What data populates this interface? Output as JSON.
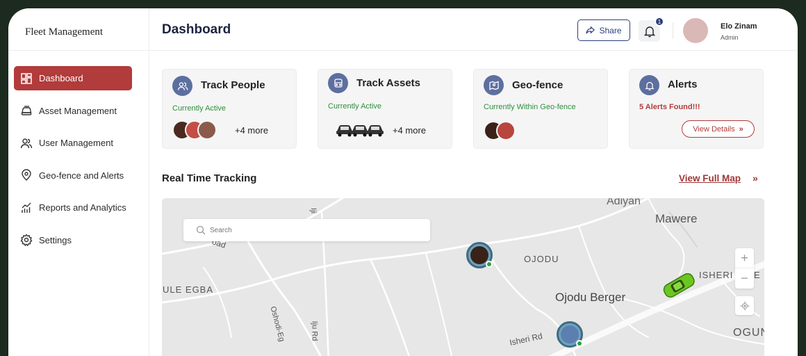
{
  "sidebar": {
    "brand": "Fleet Management",
    "items": [
      {
        "label": "Dashboard",
        "icon": "dashboard-icon"
      },
      {
        "label": "Asset Management",
        "icon": "car-icon"
      },
      {
        "label": "User Management",
        "icon": "users-icon"
      },
      {
        "label": "Geo-fence and Alerts",
        "icon": "location-pin-icon"
      },
      {
        "label": "Reports and Analytics",
        "icon": "chart-icon"
      },
      {
        "label": "Settings",
        "icon": "gear-icon"
      }
    ]
  },
  "header": {
    "title": "Dashboard",
    "share_label": "Share",
    "notification_count": "1",
    "user_name": "Elo Zinam",
    "user_role": "Admin"
  },
  "cards": {
    "track_people": {
      "title": "Track People",
      "status": "Currently Active",
      "more": "+4 more"
    },
    "track_assets": {
      "title": "Track Assets",
      "status": "Currently Active",
      "more": "+4 more"
    },
    "geofence": {
      "title": "Geo-fence",
      "status": "Currently Within Geo-fence"
    },
    "alerts": {
      "title": "Alerts",
      "status": "5 Alerts Found!!!",
      "details_label": "View Details"
    }
  },
  "tracking": {
    "title": "Real Time Tracking",
    "view_map_label": "View Full Map",
    "search_placeholder": "Search",
    "zoom_in": "+",
    "zoom_out": "−"
  },
  "map_labels": {
    "adiyan": "Adiyan",
    "mawere": "Mawere",
    "ojodu": "OJODU",
    "ojodu_berger": "Ojodu Berger",
    "ule_egba": "ULE EGBA",
    "isheri": "ISHERI",
    "isheri_rd": "Isheri Rd",
    "ogun": "OGUN",
    "road_fragment": "oad",
    "iju_rd": "Iju Rd",
    "oshodi": "Oshodi-Eg",
    "letter_e": "E",
    "letter_i": "Iji"
  },
  "colors": {
    "accent": "#b23b3b",
    "primary": "#2d3e7a",
    "icon_badge": "#5d6f9f",
    "success": "#2f8f3a"
  }
}
